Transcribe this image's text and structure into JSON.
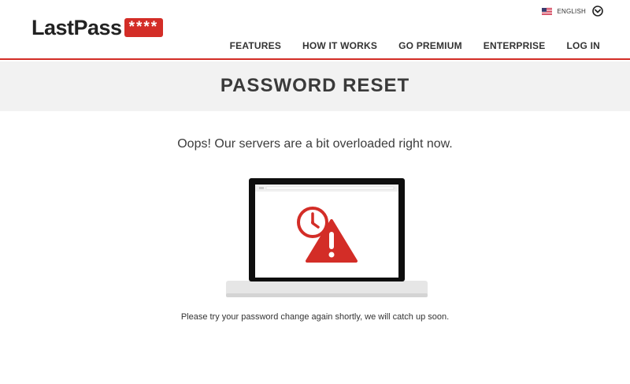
{
  "header": {
    "logo": {
      "text": "LastPass",
      "stars": "****"
    },
    "language": {
      "label": "ENGLISH",
      "flag_icon": "us-flag-icon"
    },
    "nav": [
      {
        "label": "FEATURES"
      },
      {
        "label": "HOW IT WORKS"
      },
      {
        "label": "GO PREMIUM"
      },
      {
        "label": "ENTERPRISE"
      },
      {
        "label": "LOG IN"
      }
    ]
  },
  "band": {
    "title": "PASSWORD RESET"
  },
  "main": {
    "message": "Oops! Our servers are a bit overloaded right now.",
    "illustration_icons": [
      "laptop-icon",
      "clock-icon",
      "warning-icon"
    ],
    "subtext": "Please try your password change again shortly, we will catch up soon."
  },
  "colors": {
    "brand_red": "#d32d27",
    "band_bg": "#f2f2f2",
    "text_dark": "#333333"
  }
}
